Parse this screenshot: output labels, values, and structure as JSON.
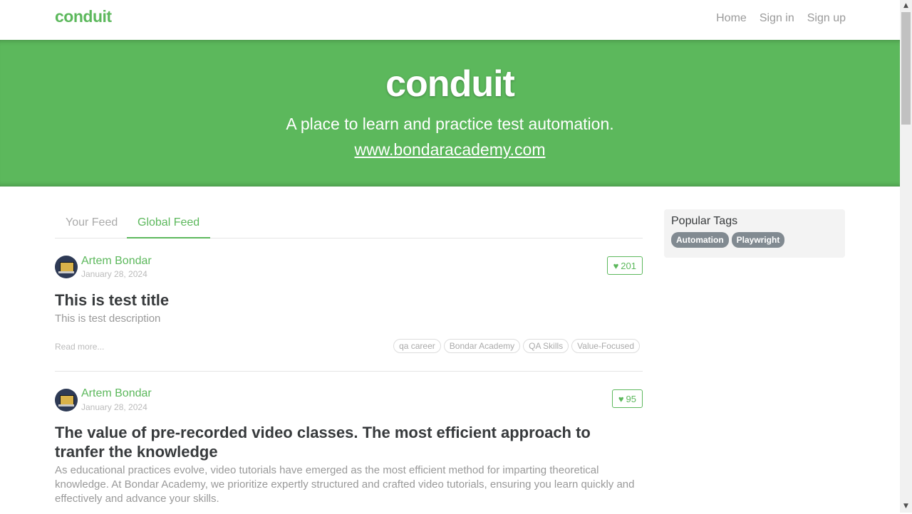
{
  "nav": {
    "brand": "conduit",
    "links": [
      "Home",
      "Sign in",
      "Sign up"
    ]
  },
  "banner": {
    "title": "conduit",
    "tagline": "A place to learn and practice test automation.",
    "link": "www.bondaracademy.com"
  },
  "feed": {
    "tabs": [
      "Your Feed",
      "Global Feed"
    ],
    "active_tab": "Global Feed",
    "articles": [
      {
        "author": "Artem Bondar",
        "date": "January 28, 2024",
        "likes": "201",
        "title": "This is test title",
        "description": "This is test description",
        "read_more": "Read more...",
        "tags": [
          "qa career",
          "Bondar Academy",
          "QA Skills",
          "Value-Focused"
        ]
      },
      {
        "author": "Artem Bondar",
        "date": "January 28, 2024",
        "likes": "95",
        "title": "The value of pre-recorded video classes. The most efficient approach to tranfer the knowledge",
        "description": "As educational practices evolve, video tutorials have emerged as the most efficient method for imparting theoretical knowledge. At Bondar Academy, we prioritize expertly structured and crafted video tutorials, ensuring you learn quickly and effectively and advance your skills."
      }
    ]
  },
  "sidebar": {
    "title": "Popular Tags",
    "tags": [
      "Automation",
      "Playwright"
    ]
  },
  "colors": {
    "brand_green": "#5cb85c",
    "tag_gray": "#818a91"
  }
}
